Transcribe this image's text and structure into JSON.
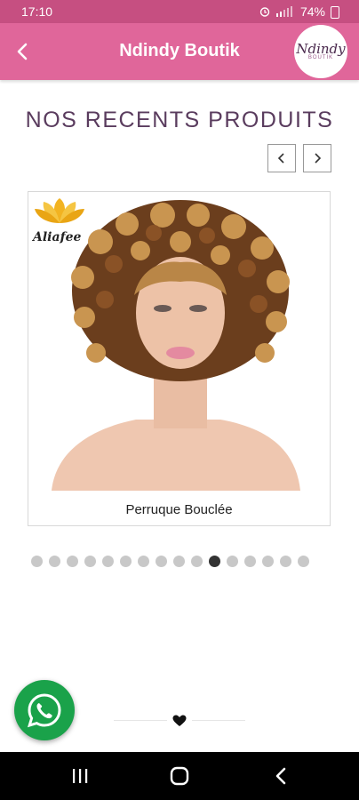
{
  "status_bar": {
    "time": "17:10",
    "battery": "74%"
  },
  "app_bar": {
    "title": "Ndindy Boutik",
    "logo_line1": "Ndindy",
    "logo_line2": "BOUTIK"
  },
  "section": {
    "title": "NOS RECENTS PRODUITS"
  },
  "carousel": {
    "product_name": "Perruque Bouclée",
    "brand_name": "Aliafee",
    "dot_count": 16,
    "active_index": 10
  },
  "colors": {
    "status_bar": "#c64f81",
    "app_bar": "#e0669a",
    "whatsapp": "#1aa24a",
    "title_text": "#5a3c5e"
  },
  "icons": {
    "back": "back-arrow-icon",
    "prev": "chevron-left-icon",
    "next": "chevron-right-icon",
    "whatsapp": "whatsapp-icon",
    "heart": "heart-icon"
  }
}
